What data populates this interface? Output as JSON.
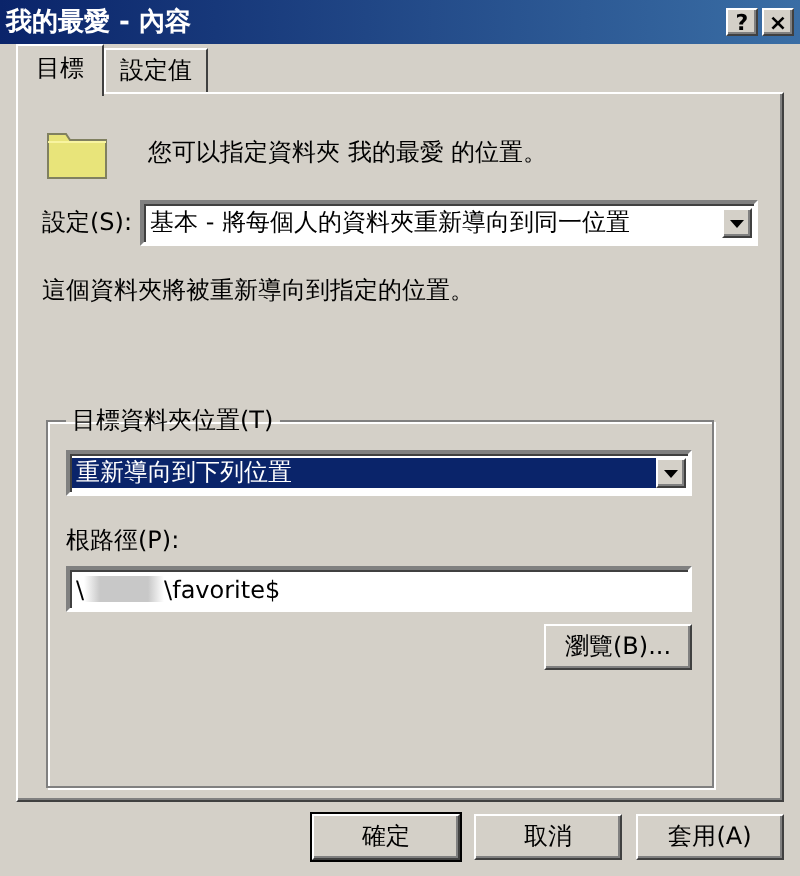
{
  "window": {
    "title": "我的最愛 - 內容",
    "help_button": "?",
    "close_button": "×"
  },
  "tabs": [
    {
      "label": "目標",
      "selected": true
    },
    {
      "label": "設定值",
      "selected": false
    }
  ],
  "intro": "您可以指定資料夾 我的最愛 的位置。",
  "setting": {
    "label": "設定(S):",
    "value": "基本 - 將每個人的資料夾重新導向到同一位置",
    "focused": false
  },
  "description": "這個資料夾將被重新導向到指定的位置。",
  "target_group": {
    "title": "目標資料夾位置(T)",
    "location": {
      "value": "重新導向到下列位置",
      "focused": true
    },
    "root_path_label": "根路徑(P):",
    "root_path_prefix": "\\",
    "root_path_redacted": true,
    "root_path_suffix": "\\favorite$",
    "browse_button": "瀏覽(B)..."
  },
  "buttons": [
    {
      "label": "確定",
      "default": true
    },
    {
      "label": "取消",
      "default": false
    },
    {
      "label": "套用(A)",
      "default": false
    }
  ]
}
